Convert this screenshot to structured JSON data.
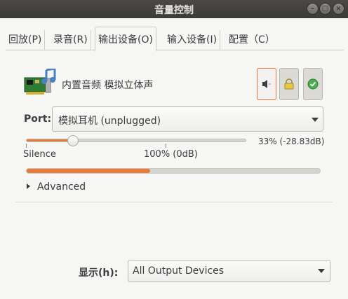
{
  "window": {
    "title": "音量控制"
  },
  "tabs": [
    {
      "label": "回放(P)"
    },
    {
      "label": "录音(R)"
    },
    {
      "label": "输出设备(O)"
    },
    {
      "label": "输入设备(I)"
    },
    {
      "label": "配置（C）"
    }
  ],
  "device": {
    "name": "内置音频 模拟立体声",
    "icon": "sound-card-icon"
  },
  "port": {
    "label": "Port:",
    "value": "模拟耳机 (unplugged)"
  },
  "volume": {
    "percent_text": "33% (-28.83dB)",
    "level": 0.33,
    "marks": {
      "silence": "Silence",
      "hundred": "100% (0dB)"
    }
  },
  "meter": {
    "level": 0.42
  },
  "advanced": {
    "label": "Advanced"
  },
  "show": {
    "label": "显示(h):",
    "value": "All Output Devices"
  },
  "colors": {
    "accent": "#e57a3c",
    "titlebar": "#3c3b37",
    "background": "#f6f6f5"
  }
}
